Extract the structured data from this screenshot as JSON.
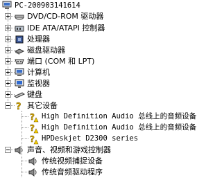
{
  "device_tree": {
    "root": {
      "label": "PC-200903141614",
      "icon": "computer-icon"
    },
    "categories": [
      {
        "label": "DVD/CD-ROM 驱动器",
        "icon": "cdrom-icon",
        "expanded": false
      },
      {
        "label": "IDE ATA/ATAPI 控制器",
        "icon": "ide-controller-icon",
        "expanded": false
      },
      {
        "label": "处理器",
        "icon": "processor-icon",
        "expanded": false
      },
      {
        "label": "磁盘驱动器",
        "icon": "disk-drive-icon",
        "expanded": false
      },
      {
        "label": "端口 (COM 和 LPT)",
        "icon": "port-icon",
        "expanded": false
      },
      {
        "label": "计算机",
        "icon": "computer-icon",
        "expanded": false
      },
      {
        "label": "监视器",
        "icon": "monitor-icon",
        "expanded": false
      },
      {
        "label": "键盘",
        "icon": "keyboard-icon",
        "expanded": false
      },
      {
        "label": "其它设备",
        "icon": "unknown-device-icon",
        "expanded": true,
        "children": [
          {
            "label": "High Definition Audio 总线上的音频设备",
            "icon": "warning-device-icon"
          },
          {
            "label": "High Definition Audio 总线上的音频设备",
            "icon": "warning-device-icon"
          },
          {
            "label": "HPDeskjet D2300 series",
            "icon": "warning-device-icon"
          }
        ]
      },
      {
        "label": "声音、视频和游戏控制器",
        "icon": "sound-icon",
        "expanded": true,
        "children": [
          {
            "label": "传统视频捕捉设备",
            "icon": "sound-device-icon"
          },
          {
            "label": "传统音频驱动程序",
            "icon": "sound-device-icon"
          }
        ]
      }
    ]
  }
}
